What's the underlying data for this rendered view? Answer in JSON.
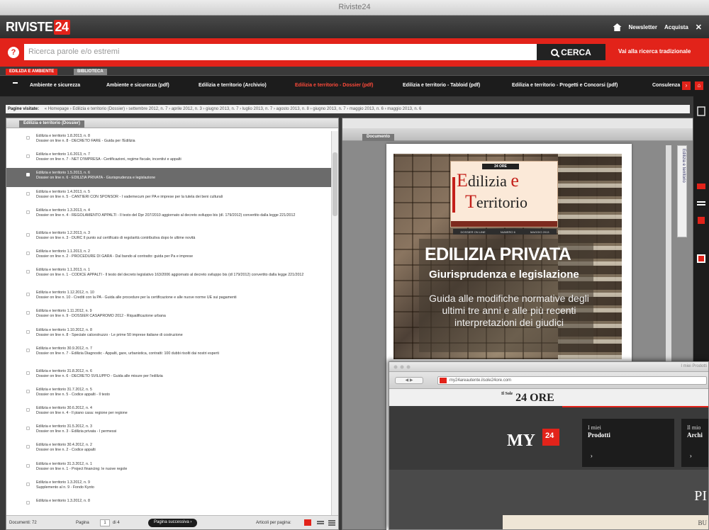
{
  "window": {
    "title": "Riviste24"
  },
  "header": {
    "logo_text": "RIVISTE",
    "logo_num": "24",
    "links": [
      "Newsletter",
      "Acquista"
    ],
    "close": "✕"
  },
  "search": {
    "help": "?",
    "placeholder": "Ricerca parole e/o estremi",
    "button": "CERCA",
    "traditional_link": "Vai alla ricerca tradizionale"
  },
  "tabs": {
    "active": "EDILIZIA E AMBIENTE",
    "inactive": "BIBLIOTECA"
  },
  "nav": {
    "items": [
      "Ambiente e sicurezza",
      "Ambiente e sicurezza (pdf)",
      "Edilizia e territorio (Archivio)",
      "Edilizia e territorio - Dossier (pdf)",
      "Edilizia e territorio - Tabloid (pdf)",
      "Edilizia e territorio - Progetti e Concorsi (pdf)",
      "Consulenza"
    ],
    "active_index": 3
  },
  "breadcrumb": {
    "label": "Pagine visitate:",
    "path": "« Homepage › Edilizia e territorio (Dossier) › settembre 2012, n. 7 › aprile 2012, n. 3 › giugno 2013, n. 7 › luglio 2013, n. 7 › agosto 2013, n. 8 › giugno 2013, n. 7 › maggio 2013, n. 6 › maggio 2013, n. 6"
  },
  "left_panel": {
    "tab": "Edilizia e territorio (Dossier)",
    "items": [
      {
        "t1": "Edilizia e territorio 1.8.2013, n. 8",
        "t2": "Dossier on line n. 8 - DECRETO FARE - Guida per l'Edilizia"
      },
      {
        "t1": "Edilizia e territorio 1.6.2013, n. 7",
        "t2": "Dossier on line n. 7 - NET D'IMPRESA - Certificazioni, regime fiscale, incentivi e appalti"
      },
      {
        "t1": "Edilizia e territorio 1.5.2013, n. 6",
        "t2": "Dossier on line n. 6 - EDILIZIA PRIVATA - Giurisprudenza e legislazione",
        "selected": true
      },
      {
        "t1": "Edilizia e territorio 1.4.2013, n. 5",
        "t2": "Dossier on line n. 5 - CANTIERI CON SPONSOR - I vademecum per PA e imprese per la tutela dei beni culturali"
      },
      {
        "t1": "Edilizia e territorio 1.3.2013, n. 4",
        "t2": "Dossier on line n. 4 - REGOLAMENTO APPALTI - Il testo del Dpr 207/2010 aggiornato al decreto sviluppo bis (dl. 179/2012) convertito dalla legge 221/2012",
        "tall": true
      },
      {
        "t1": "Edilizia e territorio 1.2.2013, n. 3",
        "t2": "Dossier on line n. 3 - DURC Il punto sul certificato di regolarità contributiva dopo le ultime novità"
      },
      {
        "t1": "Edilizia e territorio 1.1.2013, n. 2",
        "t2": "Dossier on line n. 2 - PROCEDURE DI GARA - Dal bando al contratto: guida per Pa e imprese"
      },
      {
        "t1": "Edilizia e territorio 1.1.2013, n. 1",
        "t2": "Dossier on line n. 1 - CODICE APPALTI - Il testo del decreto legislativo 163/2006 aggiornato al decreto sviluppo bis (dl 179/2012) convertito dalla legge 221/2012",
        "tall": true
      },
      {
        "t1": "Edilizia e territorio 1.12.2012, n. 10",
        "t2": "Dossier on line n. 10 - Crediti con la PA - Guida alle procedure per la certificazione e alle nuove norme UE sui pagamenti"
      },
      {
        "t1": "Edilizia e territorio 1.11.2012, n. 9",
        "t2": "Dossier on line n. 9 - DOSSIER CASAPROMO 2012 - Riqualificazione urbana"
      },
      {
        "t1": "Edilizia e territorio 1.10.2012, n. 8",
        "t2": "Dossier on line n. 8 - Speciale calcestruzzo - Le prime 50 imprese italiane di costruzione"
      },
      {
        "t1": "Edilizia e territorio 30.9.2012, n. 7",
        "t2": "Dossier on line n. 7 - Edilizia Diagnostic - Appalti, gare, urbanistica, contratti: 100 dubbi risolti dai nostri esperti",
        "tall": true
      },
      {
        "t1": "Edilizia e territorio 31.8.2012, n. 6",
        "t2": "Dossier on line n. 6 - DECRETO SVILUPPO - Guida alle misure per l'edilizia"
      },
      {
        "t1": "Edilizia e territorio 31.7.2012, n. 5",
        "t2": "Dossier on line n. 5 - Codice appalti - Il testo"
      },
      {
        "t1": "Edilizia e territorio 30.6.2012, n. 4",
        "t2": "Dossier on line n. 4 - Il piano casa: regione per regione"
      },
      {
        "t1": "Edilizia e territorio 31.5.2012, n. 3",
        "t2": "Dossier on line n. 3 - Edilizia privata - I permessi"
      },
      {
        "t1": "Edilizia e territorio 30.4.2012, n. 2",
        "t2": "Dossier on line n. 2 - Codice appalti"
      },
      {
        "t1": "Edilizia e territorio 31.3.2012, n. 1",
        "t2": "Dossier on line n. 1 - Project financing: le nuove regole"
      },
      {
        "t1": "Edilizia e territorio 1.3.2012, n. 9",
        "t2": "Supplemento al n. 9 - Fondo Kyoto"
      },
      {
        "t1": "Edilizia e territorio 1.3.2012, n. 8",
        "t2": ""
      }
    ],
    "status": {
      "docs": "Documenti: 72",
      "page_label": "Pagina",
      "page_value": "1",
      "page_total": "di 4",
      "next": "Pagina successiva ›",
      "per_page": "Articoli per pagina:"
    }
  },
  "right_panel": {
    "tab": "Documento",
    "side_label": "Edilizia e territorio",
    "cover": {
      "sole": "24 ORE",
      "mag_word1_big": "E",
      "mag_word1": "dilizia",
      "mag_word1_tail": "e",
      "mag_word2_big": "T",
      "mag_word2": "erritorio",
      "info": [
        "DOSSIER ON LINE",
        "NUMERO 6",
        "MAGGIO 2013"
      ],
      "headline": "EDILIZIA PRIVATA",
      "subhead": "Giurisprudenza e legislazione",
      "body": "Guida alle modifiche normative degli ultimi tre anni e alle più recenti interpretazioni dei giudici"
    }
  },
  "popup": {
    "title": "I miei Prodotti",
    "nav": "◀ ▶",
    "url": "my24areautente.ilsole24ore.com",
    "brand": "24 ORE",
    "brand_pre": "Il Sole",
    "my": "MY",
    "my_num": "24",
    "card1_l1": "I miei",
    "card1_l2": "Prodotti",
    "card1_arrow": "›",
    "card2_l1": "Il mio",
    "card2_l2": "Archi",
    "card2_arrow": "›",
    "pr": "PI",
    "bottom": "BU"
  },
  "colors": {
    "brand_red": "#e2231a",
    "dark": "#1c1c1c"
  }
}
